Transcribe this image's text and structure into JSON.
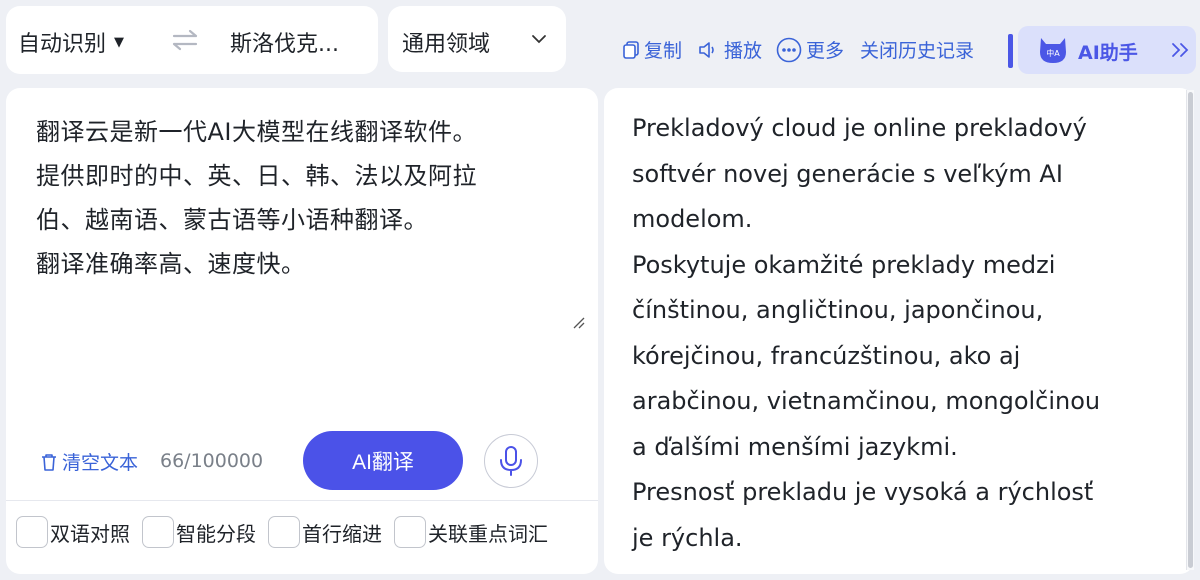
{
  "header": {
    "source_language": "自动识别",
    "target_language": "斯洛伐克...",
    "domain": "通用领域",
    "toolbar": {
      "copy": "复制",
      "play": "播放",
      "more": "更多",
      "close_history": "关闭历史记录"
    },
    "ai_assistant": {
      "avatar_text": "中A",
      "label": "AI助手"
    }
  },
  "source": {
    "text": "翻译云是新一代AI大模型在线翻译软件。\n提供即时的中、英、日、韩、法以及阿拉\n伯、越南语、蒙古语等小语种翻译。\n翻译准确率高、速度快。",
    "clear_label": "清空文本",
    "char_count": "66/100000",
    "translate_button": "AI翻译",
    "options": [
      {
        "label": "双语对照",
        "checked": false
      },
      {
        "label": "智能分段",
        "checked": false
      },
      {
        "label": "首行缩进",
        "checked": false
      },
      {
        "label": "关联重点词汇",
        "checked": false
      }
    ]
  },
  "target": {
    "text": "Prekladový cloud je online prekladový\nsoftvér novej generácie s veľkým AI\nmodelom.\nPoskytuje okamžité preklady medzi\nčínštinou, angličtinou, japončinou,\nkórejčinou, francúzštinou, ako aj\narabčinou, vietnamčinou, mongolčinou\na ďalšími menšími jazykmi.\nPresnosť prekladu je vysoká a rýchlosť\nje rýchla."
  },
  "colors": {
    "accent": "#4b52e8",
    "link": "#3a63d8",
    "assistant_bg": "#dbe0fb",
    "page_bg": "#eef0f5"
  },
  "icons": [
    "caret-down-icon",
    "swap-icon",
    "chevron-down-icon",
    "copy-icon",
    "speaker-icon",
    "more-icon",
    "ai-mascot-icon",
    "double-chevron-right-icon",
    "trash-icon",
    "microphone-icon",
    "resize-grip-icon"
  ]
}
